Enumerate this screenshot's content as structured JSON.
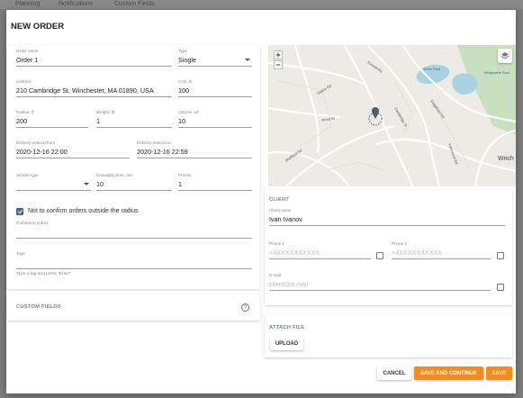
{
  "background_tabs": [
    "Planning",
    "Notifications",
    "Custom Fields"
  ],
  "dialog": {
    "title": "NEW ORDER"
  },
  "order": {
    "name": {
      "label": "Order name",
      "value": "Order 1"
    },
    "type": {
      "label": "Type",
      "value": "Single"
    },
    "address": {
      "label": "Address",
      "value": "210 Cambridge St, Winchester, MA 01890, USA"
    },
    "cost": {
      "label": "Cost, $",
      "value": "100"
    },
    "radius": {
      "label": "Radius, ft",
      "value": "200"
    },
    "weight": {
      "label": "Weight, lb",
      "value": "1"
    },
    "volume": {
      "label": "Volume, м³",
      "value": "10"
    },
    "interval_from": {
      "label": "Delivery interval from",
      "value": "2020-12-16 22:00"
    },
    "interval_to": {
      "label": "Delivery interval to",
      "value": "2020-12-16 22:59"
    },
    "vehicle_type": {
      "label": "Vehicle type",
      "value": ""
    },
    "unloading_time": {
      "label": "Unloading time, min",
      "value": "10"
    },
    "priority": {
      "label": "Priority",
      "value": "1"
    },
    "confirm_checkbox": {
      "label": "Not to confirm orders outside the radius",
      "checked": true
    },
    "comment": {
      "label": "Comment (order)",
      "value": ""
    },
    "tags": {
      "label": "Tags",
      "hint": "Type a tag and press \"Enter\""
    }
  },
  "custom_fields": {
    "title": "CUSTOM FIELDS",
    "help_icon": "?"
  },
  "map": {
    "zoom_in": "+",
    "zoom_out": "−",
    "place_labels": [
      "Wrich",
      "Winter Pond",
      "Wedgemere Pond"
    ],
    "street_labels": [
      "Cambridge St",
      "Pond St",
      "Ridgefield Rd",
      "Squire Rd",
      "Everett Rd",
      "Fairmount Rd",
      "Sheffield Rd"
    ],
    "water_color": "#aad3df",
    "park_color": "#c8dfc0",
    "marker_color": "#4d5d6e"
  },
  "client": {
    "title": "CLIENT",
    "name": {
      "label": "Client name",
      "value": "Ivan Ivanov"
    },
    "phone1": {
      "label": "Phone 1",
      "placeholder": "+4XXXXXXXXXX"
    },
    "phone2": {
      "label": "Phone 2",
      "placeholder": "+4XXXXXXXXXX"
    },
    "email": {
      "label": "E-mail",
      "placeholder": "client@e.mail"
    }
  },
  "attach": {
    "title": "ATTACH FILE",
    "upload_label": "UPLOAD"
  },
  "footer": {
    "cancel_label": "CANCEL",
    "save_continue_label": "SAVE AND CONTINUE",
    "save_label": "SAVE"
  },
  "colors": {
    "accent": "#f28c1e",
    "checkbox": "#4a6a8a"
  }
}
